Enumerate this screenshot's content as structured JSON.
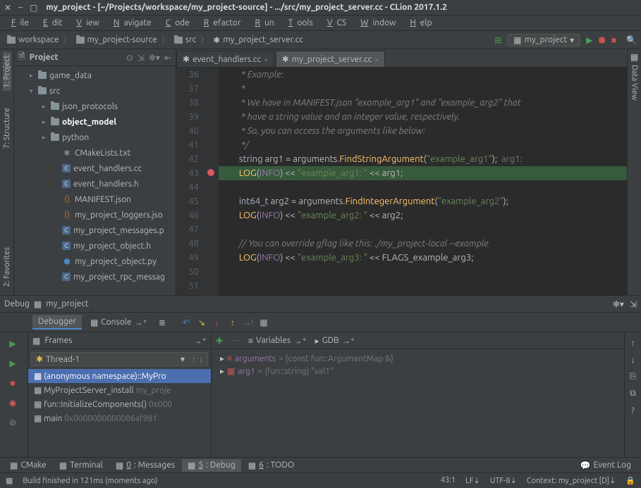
{
  "title": "my_project - [~/Projects/workspace/my_project-source] - .../src/my_project_server.cc - CLion 2017.1.2",
  "menu": [
    "File",
    "Edit",
    "View",
    "Navigate",
    "Code",
    "Refactor",
    "Run",
    "Tools",
    "VCS",
    "Window",
    "Help"
  ],
  "crumbs": [
    "workspace",
    "my_project-source",
    "src",
    "my_project_server.cc"
  ],
  "run_config": "my_project",
  "project_panel_title": "Project",
  "tree": [
    {
      "depth": 1,
      "arrow": "▸",
      "icon": "folder",
      "label": "game_data"
    },
    {
      "depth": 1,
      "arrow": "▾",
      "icon": "folder",
      "label": "src"
    },
    {
      "depth": 2,
      "arrow": "▸",
      "icon": "folder",
      "label": "json_protocols"
    },
    {
      "depth": 2,
      "arrow": "▸",
      "icon": "folder",
      "label": "object_model",
      "bold": true
    },
    {
      "depth": 2,
      "arrow": "▸",
      "icon": "folder",
      "label": "python"
    },
    {
      "depth": 3,
      "arrow": "",
      "icon": "txt",
      "label": "CMakeLists.txt"
    },
    {
      "depth": 3,
      "arrow": "",
      "icon": "c",
      "label": "event_handlers.cc"
    },
    {
      "depth": 3,
      "arrow": "",
      "icon": "c",
      "label": "event_handlers.h"
    },
    {
      "depth": 3,
      "arrow": "",
      "icon": "json",
      "label": "MANIFEST.json"
    },
    {
      "depth": 3,
      "arrow": "",
      "icon": "json",
      "label": "my_project_loggers.jso"
    },
    {
      "depth": 3,
      "arrow": "",
      "icon": "c",
      "label": "my_project_messages.p"
    },
    {
      "depth": 3,
      "arrow": "",
      "icon": "c",
      "label": "my_project_object.h"
    },
    {
      "depth": 3,
      "arrow": "",
      "icon": "py",
      "label": "my_project_object.py"
    },
    {
      "depth": 3,
      "arrow": "",
      "icon": "c",
      "label": "my_project_rpc_messag"
    }
  ],
  "tabs": [
    {
      "label": "event_handlers.cc",
      "active": false
    },
    {
      "label": "my_project_server.cc",
      "active": true
    }
  ],
  "code_start_line": 36,
  "exec_line": 43,
  "code": [
    {
      "n": 36,
      "html": "        <span class='cmt'>* Example:</span>"
    },
    {
      "n": 37,
      "html": "        <span class='cmt'>*</span>"
    },
    {
      "n": 38,
      "html": "        <span class='cmt'>* We have in MANIFEST.json \"example_arg1\" and \"example_arg2\" that </span>"
    },
    {
      "n": 39,
      "html": "        <span class='cmt'>* have a string value and an integer value, respectively.</span>"
    },
    {
      "n": 40,
      "html": "        <span class='cmt'>* So, you can access the arguments like below:</span>"
    },
    {
      "n": 41,
      "html": "        <span class='cmt'>*/</span>"
    },
    {
      "n": 42,
      "html": "       <span class='type'>string</span> arg1 = arguments.<span class='fn'>FindStringArgument</span>(<span class='str'>\"example_arg1\"</span>);  <span class='param'>arg1:</span>"
    },
    {
      "n": 43,
      "html": "       <span class='fn'>LOG</span>(<span class='const'>INFO</span>) &lt;&lt; <span class='str'>\"example_arg1: \"</span> &lt;&lt; arg1;"
    },
    {
      "n": 44,
      "html": ""
    },
    {
      "n": 45,
      "html": "       <span class='type'>int64_t</span> arg2 = arguments.<span class='fn'>FindIntegerArgument</span>(<span class='str'>\"example_arg2\"</span>);"
    },
    {
      "n": 46,
      "html": "       <span class='fn'>LOG</span>(<span class='const'>INFO</span>) &lt;&lt; <span class='str'>\"example_arg2: \"</span> &lt;&lt; arg2;"
    },
    {
      "n": 47,
      "html": ""
    },
    {
      "n": 48,
      "html": "       <span class='cmt'>// You can override gflag like this: ./my_project-local --example</span>"
    },
    {
      "n": 49,
      "html": "       <span class='fn'>LOG</span>(<span class='const'>INFO</span>) &lt;&lt; <span class='str'>\"example_arg3: \"</span> &lt;&lt; FLAGS_example_arg3;"
    },
    {
      "n": 50,
      "html": ""
    },
    {
      "n": 51,
      "html": ""
    }
  ],
  "debug_title": "Debug",
  "debug_config": "my_project",
  "dbg_tabs": {
    "debugger": "Debugger",
    "console": "Console"
  },
  "frames_title": "Frames",
  "vars_title": "Variables",
  "gdb_title": "GDB",
  "thread": "Thread-1",
  "frames": [
    {
      "label": "(anonymous namespace)::MyPro",
      "sel": true
    },
    {
      "label": "MyProjectServer_install",
      "dim": "my_proje"
    },
    {
      "label": "fun::InitializeComponents()",
      "dim": "0x000"
    },
    {
      "label": "main",
      "dim": "0x0000000000006af981"
    }
  ],
  "vars": [
    {
      "icon": "≡",
      "name": "arguments",
      "val": "= {const fun::ArgumentMap &}"
    },
    {
      "icon": "▦",
      "name": "arg1",
      "val": "= {fun::string} \"val1\""
    }
  ],
  "bottom_tabs": [
    {
      "label": "CMake",
      "key": "",
      "active": false
    },
    {
      "label": "Terminal",
      "key": "",
      "active": false
    },
    {
      "label": "0: Messages",
      "key": "0",
      "active": false
    },
    {
      "label": "5: Debug",
      "key": "5",
      "active": true
    },
    {
      "label": "6: TODO",
      "key": "6",
      "active": false
    }
  ],
  "event_log": "Event Log",
  "status_msg": "Build finished in 121ms (moments ago)",
  "status_right": {
    "pos": "43:1",
    "lf": "LF⇣",
    "enc": "UTF-8⇣",
    "ctx": "Context: my_project [D]⇣",
    "lock": "🔒"
  },
  "side_tabs": {
    "project": "1: Project",
    "structure": "7: Structure",
    "favorites": "2: Favorites",
    "data_view": "Data View"
  }
}
